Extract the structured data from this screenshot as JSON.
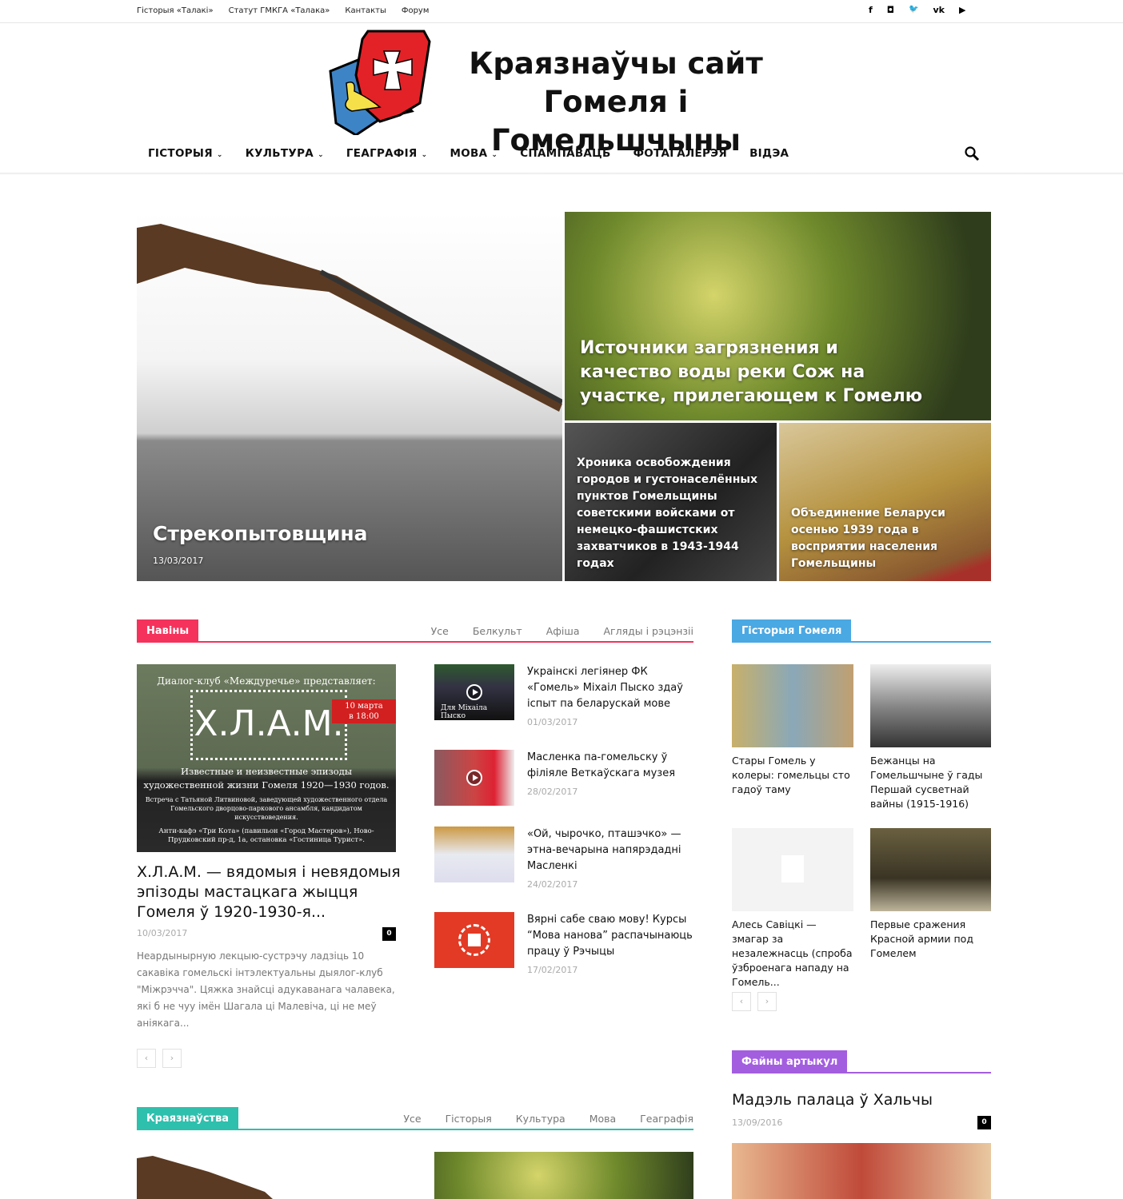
{
  "topbar": {
    "links": [
      "Гісторыя «Талакі»",
      "Статут ГМКГА «Талака»",
      "Кантакты",
      "Форум"
    ],
    "social": [
      "facebook-icon",
      "instagram-icon",
      "twitter-icon",
      "vk-icon",
      "youtube-icon"
    ],
    "social_glyphs": [
      "f",
      "◘",
      "🐦",
      "vk",
      "▶"
    ]
  },
  "header": {
    "title_line1": "Краязнаўчы сайт",
    "title_line2": "Гомеля і Гомельшчыны"
  },
  "nav": {
    "items": [
      {
        "label": "ГІСТОРЫЯ",
        "dropdown": "⌄"
      },
      {
        "label": "КУЛЬТУРА",
        "dropdown": "⌄"
      },
      {
        "label": "ГЕАГРАФІЯ",
        "dropdown": "⌄"
      },
      {
        "label": "МОВА",
        "dropdown": "⌄"
      },
      {
        "label": "СПАМПАВАЦЬ"
      },
      {
        "label": "ФОТАГАЛЕРЭЯ"
      },
      {
        "label": "ВІДЭА"
      }
    ]
  },
  "featured": {
    "main": {
      "title": "Стрекопытовщина",
      "date": "13/03/2017"
    },
    "top_right": {
      "title": "Источники загрязнения и качество воды реки Сож на участке, прилегающем к Гомелю"
    },
    "bottom_left": {
      "title": "Хроника освобождения городов и густонаселённых пунктов Гомельщины советскими войсками от немецко-фашистских захватчиков в 1943-1944 годах"
    },
    "bottom_right": {
      "title": "Объединение Беларуси осенью 1939 года в восприятии населения Гомельщины"
    }
  },
  "news": {
    "label": "Навіны",
    "color": "#f5325c",
    "tabs": [
      "Усе",
      "Белкульт",
      "Афіша",
      "Агляды і рэцэнзіі"
    ],
    "main": {
      "image_text": {
        "l1": "Диалог-клуб «Междуречье» представляет:",
        "big": "Х.Л.А.М.",
        "badge1": "10 марта",
        "badge2": "в 18:00",
        "l2": "Известные и неизвестные эпизоды",
        "l3": "художественной жизни Гомеля 1920—1930 годов.",
        "l4": "Встреча с Татьяной Литвиновой, заведующей художественного отдела Гомельского дворцово-паркового ансамбля, кандидатом искусствоведения.",
        "l5": "Анти-кафэ «Три Кота» (павильон «Город Мастеров»), Ново-Прудковский пр-д, 1а, остановка «Гостиница Турист»."
      },
      "title": "Х.Л.А.М. — вядомыя і невядомыя эпізоды мастацкага жыцця Гомеля ў 1920-1930-я...",
      "date": "10/03/2017",
      "comments": "0",
      "excerpt": "Неардынырную лекцыю-сустрэчу ладзіць 10 сакавіка гомельскі інтэлектуальны дыялог-клуб \"Міжрэчча\". Цяжка знайсці адукаванага чалавека, які б не чуу імён Шагала ці Малевіча, ці не меў аніякага..."
    },
    "list": [
      {
        "title": "Украінскі легіянер ФК «Гомель» Міхаіл Пыско здаў іспыт па беларускай мове",
        "date": "01/03/2017",
        "video": true,
        "thumb_text": "Для Міхаіла Пыско"
      },
      {
        "title": "Масленка па-гомельску ў філіяле Веткаўскага музея",
        "date": "28/02/2017",
        "video": true
      },
      {
        "title": "«Ой, чырочко, пташэчко» — этна-вечарына напярэдадні Масленкі",
        "date": "24/02/2017",
        "video": false
      },
      {
        "title": "Вярні сабе сваю мову! Курсы “Мова нанова” распачынаюць працу ў Рэчыцы",
        "date": "17/02/2017",
        "video": false
      }
    ],
    "pager": {
      "prev": "‹",
      "next": "›"
    }
  },
  "history": {
    "label": "Гісторыя Гомеля",
    "color": "#4aa8e3",
    "items": [
      {
        "title": "Стары Гомель у колеры: гомельцы сто гадоў таму"
      },
      {
        "title": "Бежанцы на Гомельшчыне ў гады Першай сусветнай вайны (1915-1916)"
      },
      {
        "title": "Алесь Савіцкі — змагар за незалежнасць (спроба ўзброенага нападу на Гомель..."
      },
      {
        "title": "Первые сражения Красной армии под Гомелем"
      }
    ],
    "pager": {
      "prev": "‹",
      "next": "›"
    }
  },
  "files": {
    "label": "Файны артыкул",
    "color": "#a35ee0",
    "title": "Мадэль палаца ў Хальчы",
    "date": "13/09/2016",
    "comments": "0"
  },
  "local": {
    "label": "Краязнаўства",
    "color": "#2fbfad",
    "tabs": [
      "Усе",
      "Гісторыя",
      "Культура",
      "Мова",
      "Геаграфія"
    ]
  }
}
